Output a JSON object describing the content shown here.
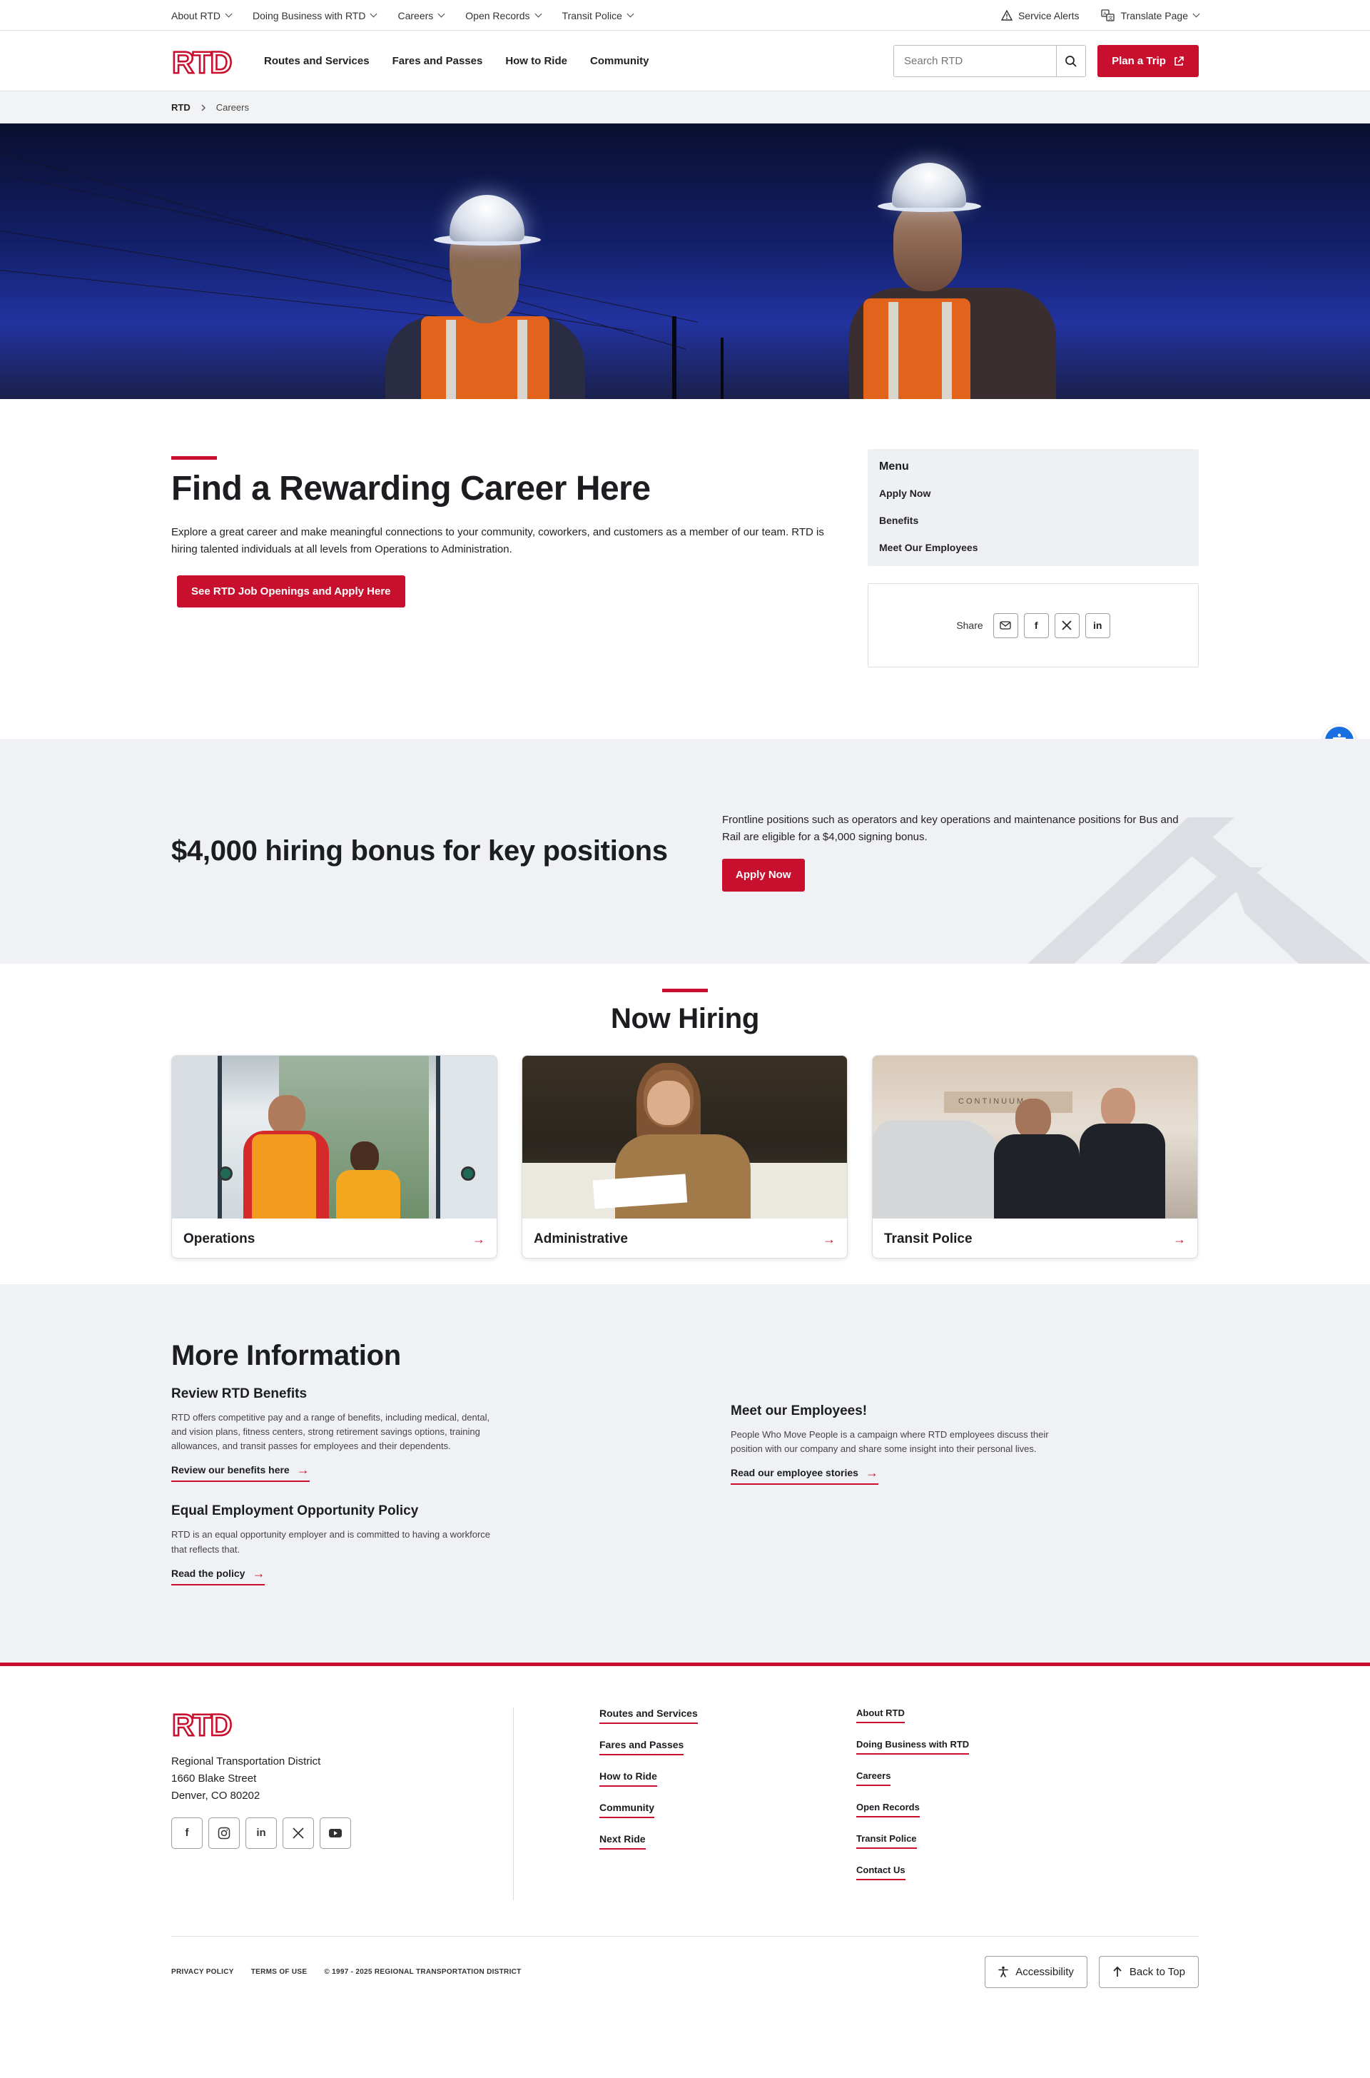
{
  "utility": {
    "left": [
      {
        "label": "About RTD"
      },
      {
        "label": "Doing Business with RTD"
      },
      {
        "label": "Careers"
      },
      {
        "label": "Open Records"
      },
      {
        "label": "Transit Police"
      }
    ],
    "service_alerts": "Service Alerts",
    "translate": "Translate Page"
  },
  "header": {
    "logo_text": "RTD",
    "nav": [
      "Routes and Services",
      "Fares and Passes",
      "How to Ride",
      "Community"
    ],
    "search_placeholder": "Search RTD",
    "plan_trip": "Plan a Trip"
  },
  "breadcrumb": {
    "home": "RTD",
    "current": "Careers"
  },
  "intro": {
    "title": "Find a Rewarding Career Here",
    "text": "Explore a great career and make meaningful connections to your community, coworkers, and customers as a member of our team. RTD is hiring talented individuals at all levels from Operations to Administration.",
    "cta": "See RTD Job Openings and Apply Here"
  },
  "sidemenu": {
    "title": "Menu",
    "items": [
      "Apply Now",
      "Benefits",
      "Meet Our Employees"
    ]
  },
  "share": {
    "label": "Share",
    "buttons": [
      "email-icon",
      "facebook-icon",
      "x-icon",
      "linkedin-icon"
    ]
  },
  "bonus": {
    "title": "$4,000 hiring bonus for key positions",
    "text": "Frontline positions such as operators and key operations and maintenance positions for Bus and Rail are eligible for a $4,000 signing bonus.",
    "button": "Apply Now"
  },
  "hiring": {
    "title": "Now Hiring",
    "cards": [
      {
        "label": "Operations"
      },
      {
        "label": "Administrative"
      },
      {
        "label": "Transit Police"
      }
    ],
    "photo_sign": "CONTINUUM"
  },
  "more": {
    "title": "More Information",
    "left": [
      {
        "title": "Review RTD Benefits",
        "text": "RTD offers competitive pay and a range of benefits, including medical, dental, and vision plans, fitness centers, strong retirement savings options, training allowances, and transit passes for employees and their dependents.",
        "link": "Review our benefits here"
      },
      {
        "title": "Equal Employment Opportunity Policy",
        "text": "RTD is an equal opportunity employer and is committed to having a workforce that reflects that.",
        "link": "Read the policy"
      }
    ],
    "right": {
      "title": "Meet our Employees!",
      "text": "People Who Move People is a campaign where RTD employees discuss their position with our company and share some insight into their personal lives.",
      "link": "Read our employee stories"
    }
  },
  "footer": {
    "org": "Regional Transportation District",
    "street": "1660 Blake Street",
    "city": "Denver, CO 80202",
    "col2": [
      "Routes and Services",
      "Fares and Passes",
      "How to Ride",
      "Community",
      "Next Ride"
    ],
    "col3": [
      "About RTD",
      "Doing Business with RTD",
      "Careers",
      "Open Records",
      "Transit Police",
      "Contact Us"
    ],
    "legal": [
      "PRIVACY POLICY",
      "TERMS OF USE",
      "© 1997 - 2025 REGIONAL TRANSPORTATION DISTRICT"
    ],
    "accessibility": "Accessibility",
    "back_to_top": "Back to Top"
  },
  "colors": {
    "brand_red": "#c8102e",
    "band_gray": "#f0f1f5",
    "a11y_blue": "#1a6fe0"
  }
}
